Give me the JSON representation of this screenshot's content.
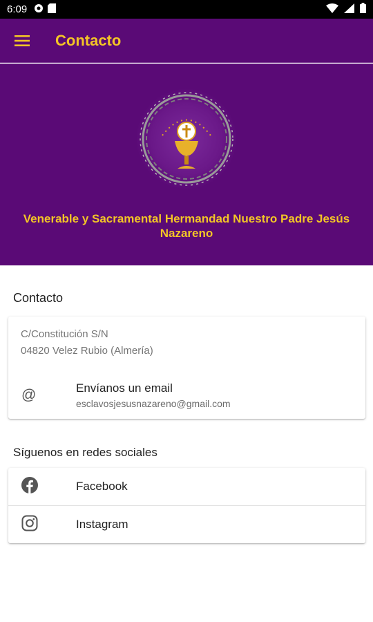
{
  "status_bar": {
    "time": "6:09"
  },
  "app_bar": {
    "title": "Contacto"
  },
  "hero": {
    "title": "Venerable y Sacramental Hermandad Nuestro Padre Jesús Nazareno"
  },
  "contact_section": {
    "heading": "Contacto",
    "address_line1": "C/Constitución S/N",
    "address_line2": "04820 Velez Rubio (Almería)",
    "email_label": "Envíanos un email",
    "email_value": "esclavosjesusnazareno@gmail.com",
    "email_icon_glyph": "@"
  },
  "social_section": {
    "heading": "Síguenos en redes sociales",
    "items": [
      {
        "label": "Facebook",
        "icon": "facebook-icon"
      },
      {
        "label": "Instagram",
        "icon": "instagram-icon"
      }
    ]
  },
  "colors": {
    "primary": "#5a0a76",
    "accent": "#f3c526"
  }
}
